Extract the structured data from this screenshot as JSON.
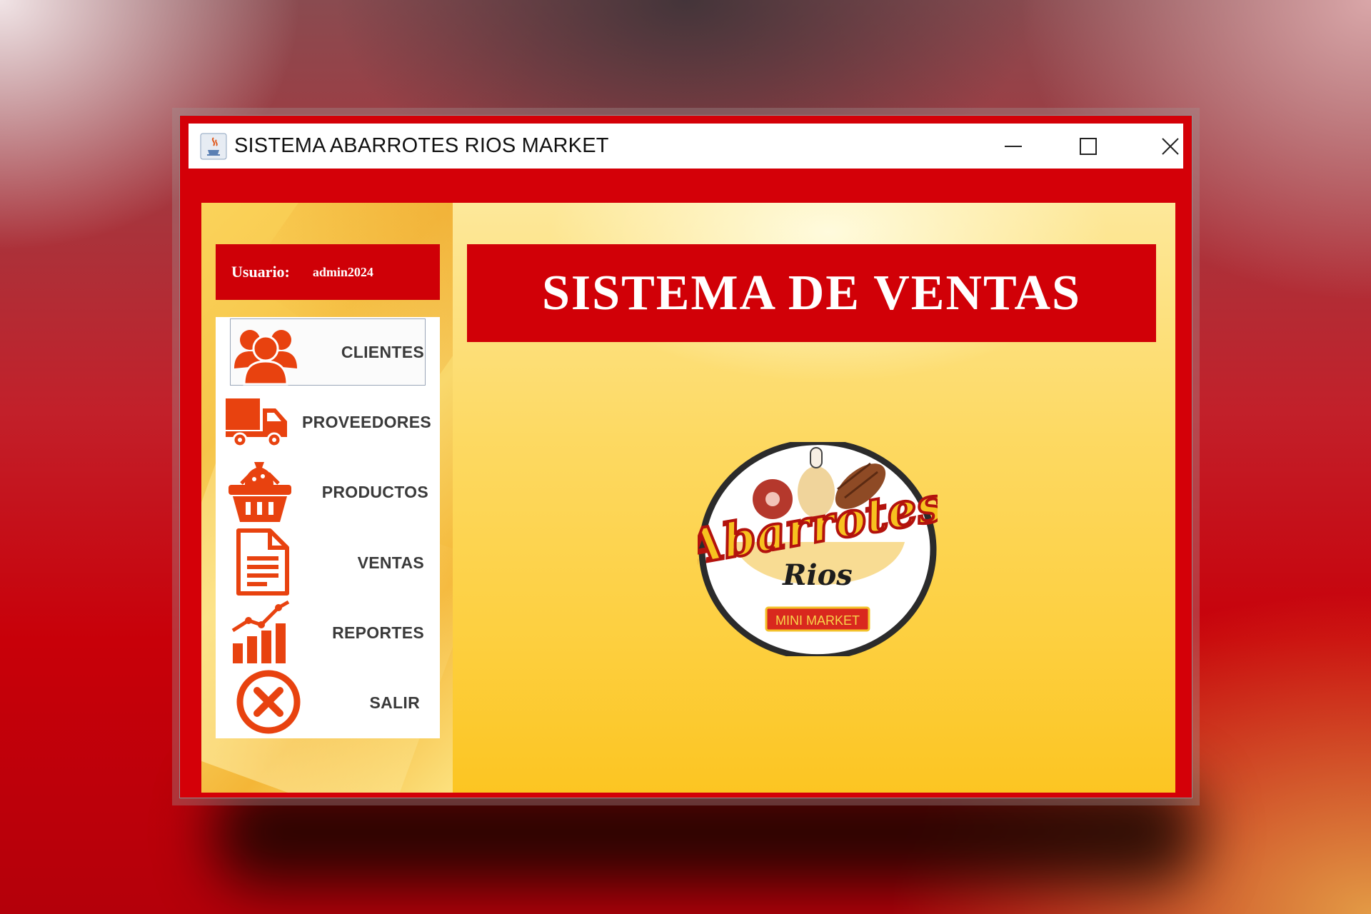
{
  "window": {
    "title": "SISTEMA ABARROTES RIOS MARKET",
    "controls": [
      "minimize-icon",
      "maximize-icon",
      "close-icon"
    ]
  },
  "user": {
    "label": "Usuario:",
    "name": "admin2024"
  },
  "menu": [
    {
      "label": "CLIENTES",
      "icon": "users-icon",
      "selected": true
    },
    {
      "label": "PROVEEDORES",
      "icon": "truck-icon",
      "selected": false
    },
    {
      "label": "PRODUCTOS",
      "icon": "basket-icon",
      "selected": false
    },
    {
      "label": "VENTAS",
      "icon": "document-icon",
      "selected": false
    },
    {
      "label": "REPORTES",
      "icon": "chart-icon",
      "selected": false
    },
    {
      "label": "SALIR",
      "icon": "exit-icon",
      "selected": false
    }
  ],
  "banner": {
    "title": "SISTEMA DE VENTAS"
  },
  "logo": {
    "brand": "Abarrotes",
    "name": "Rios",
    "tag": "MINI MARKET"
  },
  "colors": {
    "accent_red": "#d10007",
    "icon_orange": "#e8420f",
    "panel_yellow": "#fdd962"
  }
}
